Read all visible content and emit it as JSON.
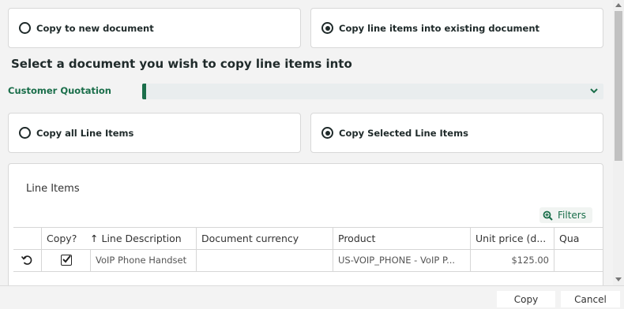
{
  "copy_mode": {
    "new_document_label": "Copy to new document",
    "existing_document_label": "Copy line items into existing document",
    "selected": "existing"
  },
  "section_heading": "Select a document you wish to copy line items into",
  "customer_quotation": {
    "label": "Customer Quotation",
    "value": ""
  },
  "line_selection": {
    "all_label": "Copy all Line Items",
    "selected_label": "Copy Selected Line Items",
    "selected": "selected"
  },
  "line_items": {
    "title": "Line Items",
    "filters_label": "Filters",
    "columns": {
      "copy": "Copy?",
      "description": "Line Description",
      "currency": "Document currency",
      "product": "Product",
      "unit_price": "Unit price (d...",
      "quantity": "Qua"
    },
    "rows": [
      {
        "copy": true,
        "description": "VoIP Phone Handset",
        "currency": "",
        "product": "US-VOIP_PHONE - VoIP P...",
        "unit_price": "$125.00",
        "quantity": ""
      }
    ]
  },
  "footer": {
    "copy_label": "Copy",
    "cancel_label": "Cancel"
  },
  "colors": {
    "accent": "#1a6e4a",
    "text": "#1f2a2a"
  }
}
